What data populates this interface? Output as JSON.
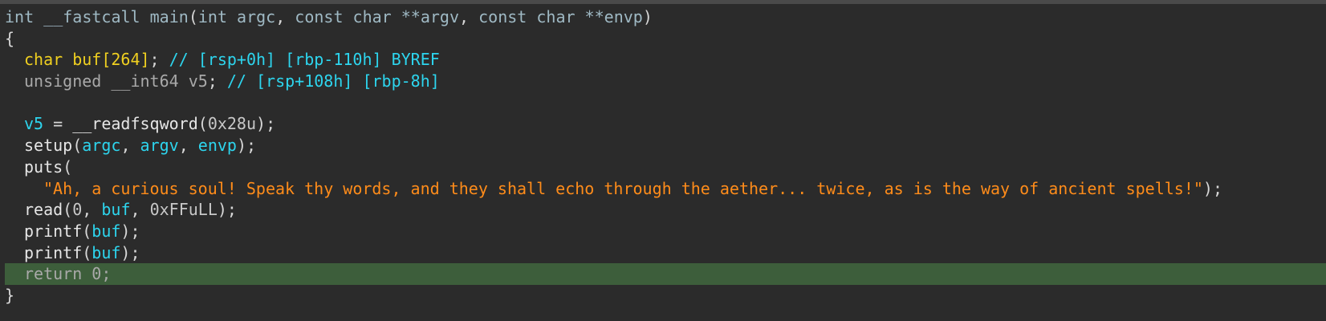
{
  "code": {
    "l1": {
      "ret": "int",
      "conv": "__fastcall",
      "name": "main",
      "p1type": "int",
      "p1": "argc",
      "p2type": "const char **",
      "p2": "argv",
      "p3type": "const char **",
      "p3": "envp"
    },
    "l2": {
      "brace": "{"
    },
    "l3": {
      "type": "char",
      "name": "buf[264]",
      "comment": "// [rsp+0h] [rbp-110h] BYREF"
    },
    "l4": {
      "type": "unsigned __int64",
      "name": "v5",
      "comment": "// [rsp+108h] [rbp-8h]"
    },
    "l6": {
      "var": "v5",
      "fn": "__readfsqword",
      "arg": "0x28u"
    },
    "l7": {
      "fn": "setup",
      "a1": "argc",
      "a2": "argv",
      "a3": "envp"
    },
    "l8": {
      "fn": "puts"
    },
    "l9": {
      "str": "\"Ah, a curious soul! Speak thy words, and they shall echo through the aether... twice, as is the way of ancient spells!\""
    },
    "l10": {
      "fn": "read",
      "a1": "0",
      "a2": "buf",
      "a3": "0xFFuLL"
    },
    "l11": {
      "fn": "printf",
      "a1": "buf"
    },
    "l12": {
      "fn": "printf",
      "a1": "buf"
    },
    "l13": {
      "kw": "return",
      "val": "0"
    },
    "l14": {
      "brace": "}"
    }
  },
  "colors": {
    "background": "#2b2b2b",
    "highlight": "#3d5e3b",
    "string": "#ff8c1a",
    "variable": "#2dd5ee",
    "global": "#f0d020"
  }
}
